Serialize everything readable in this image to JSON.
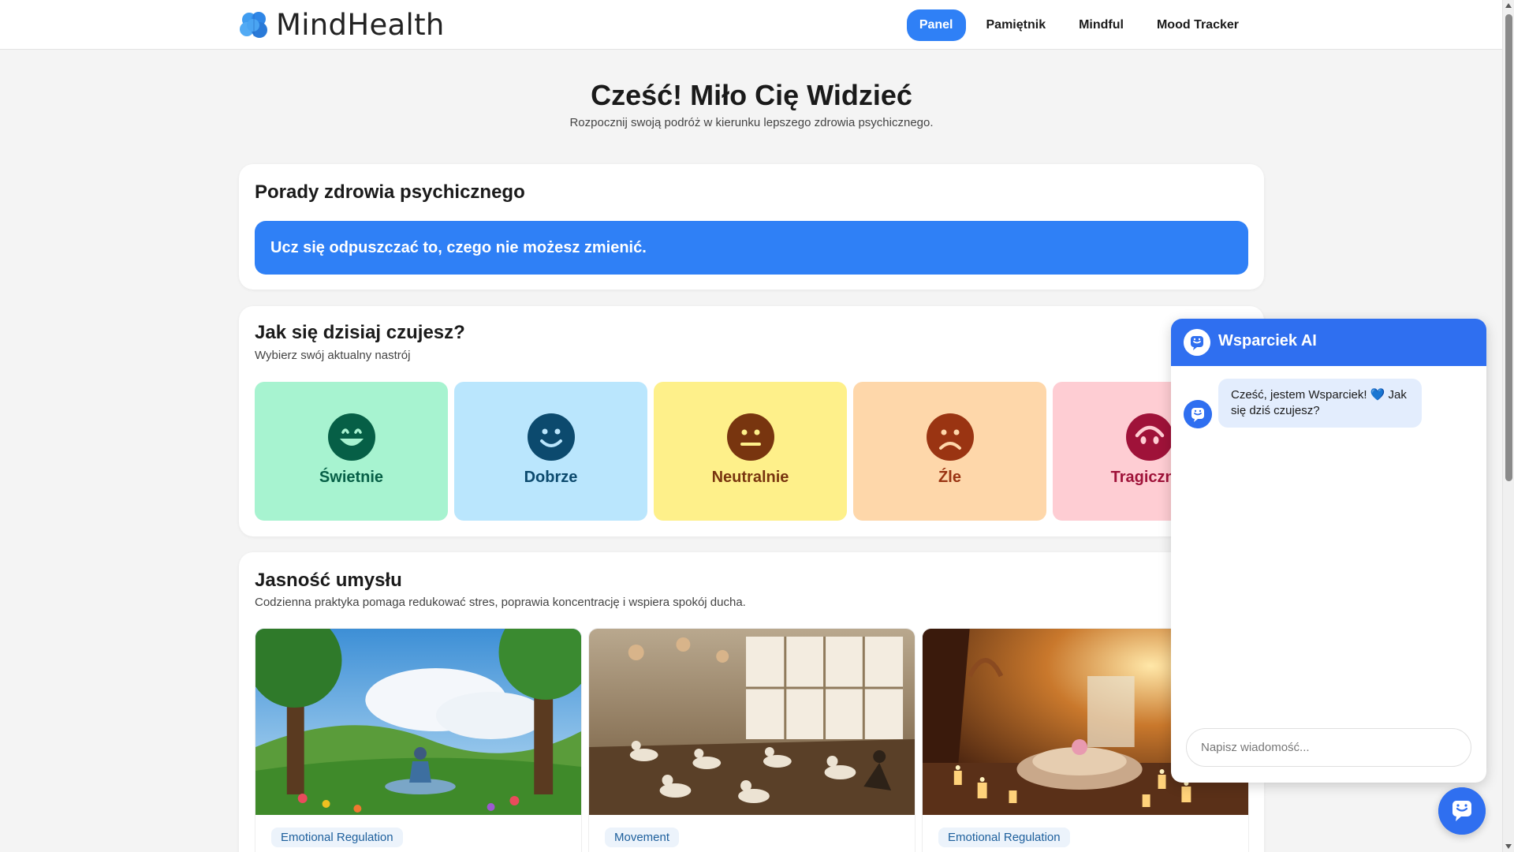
{
  "app": {
    "name": "MindHealth"
  },
  "nav": {
    "items": [
      {
        "label": "Panel",
        "active": true
      },
      {
        "label": "Pamiętnik",
        "active": false
      },
      {
        "label": "Mindful",
        "active": false
      },
      {
        "label": "Mood Tracker",
        "active": false
      }
    ]
  },
  "hero": {
    "title": "Cześć! Miło Cię Widzieć",
    "subtitle": "Rozpocznij swoją podróż w kierunku lepszego zdrowia psychicznego."
  },
  "tips": {
    "title": "Porady zdrowia psychicznego",
    "tip": "Ucz się odpuszczać to, czego nie możesz zmienić."
  },
  "mood": {
    "title": "Jak się dzisiaj czujesz?",
    "subtitle": "Wybierz swój aktualny nastrój",
    "options": [
      {
        "label": "Świetnie",
        "icon": "grin-icon",
        "bg": "#a7f3d0",
        "fg": "#065f46"
      },
      {
        "label": "Dobrze",
        "icon": "smile-icon",
        "bg": "#bae6fd",
        "fg": "#0c4a6e"
      },
      {
        "label": "Neutralnie",
        "icon": "neutral-face-icon",
        "bg": "#fef08a",
        "fg": "#78350f"
      },
      {
        "label": "Źle",
        "icon": "frown-icon",
        "bg": "#fed7aa",
        "fg": "#9a3412"
      },
      {
        "label": "Tragicznie",
        "icon": "sad-face-icon",
        "bg": "#fecdd3",
        "fg": "#9f1239"
      }
    ]
  },
  "clarity": {
    "title": "Jasność umysłu",
    "subtitle": "Codzienna praktyka pomaga redukować stres, poprawia koncentrację i wspiera spokój ducha.",
    "cards": [
      {
        "tag": "Emotional Regulation",
        "image": "meditation-in-nature"
      },
      {
        "tag": "Movement",
        "image": "group-yoga-studio"
      },
      {
        "tag": "Emotional Regulation",
        "image": "candlelit-relaxation-room"
      }
    ]
  },
  "chat": {
    "title": "Wsparciek AI",
    "message": "Cześć, jestem Wsparciek! 💙 Jak się dziś czujesz?",
    "input_placeholder": "Napisz wiadomość..."
  },
  "colors": {
    "accent": "#2f80f6",
    "chat_header": "#2f6ff0",
    "background": "#f4f4f4"
  }
}
